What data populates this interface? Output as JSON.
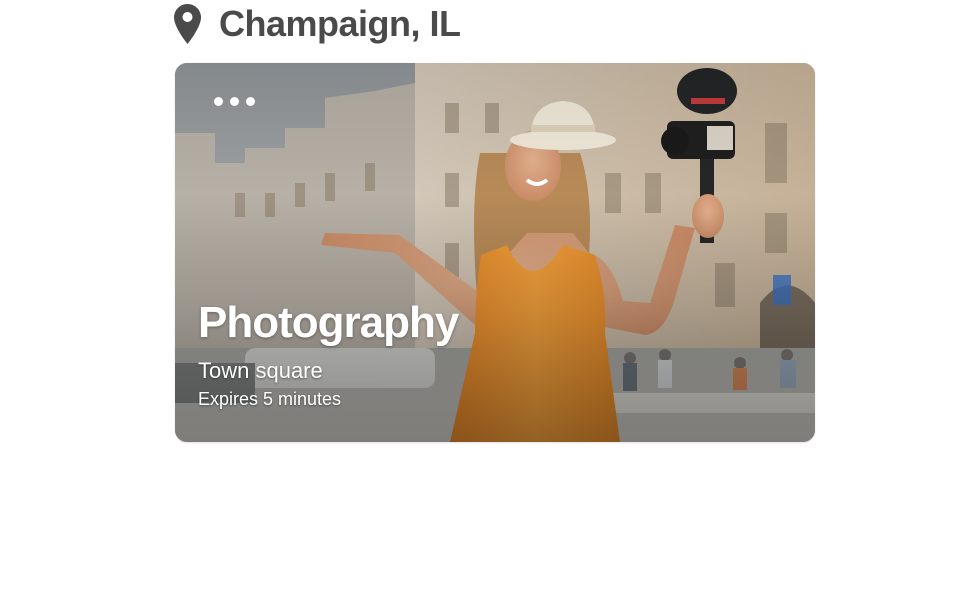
{
  "header": {
    "location": "Champaign, IL",
    "icon": "location-pin-icon"
  },
  "card": {
    "title": "Photography",
    "place": "Town square",
    "expiry": "Expires 5 minutes",
    "menu_icon": "more-horizontal-icon",
    "image": "woman-with-camera-photo"
  },
  "colors": {
    "heading": "#4a4a4a",
    "dress": "#f19a31",
    "text_on_image": "#ffffff"
  }
}
